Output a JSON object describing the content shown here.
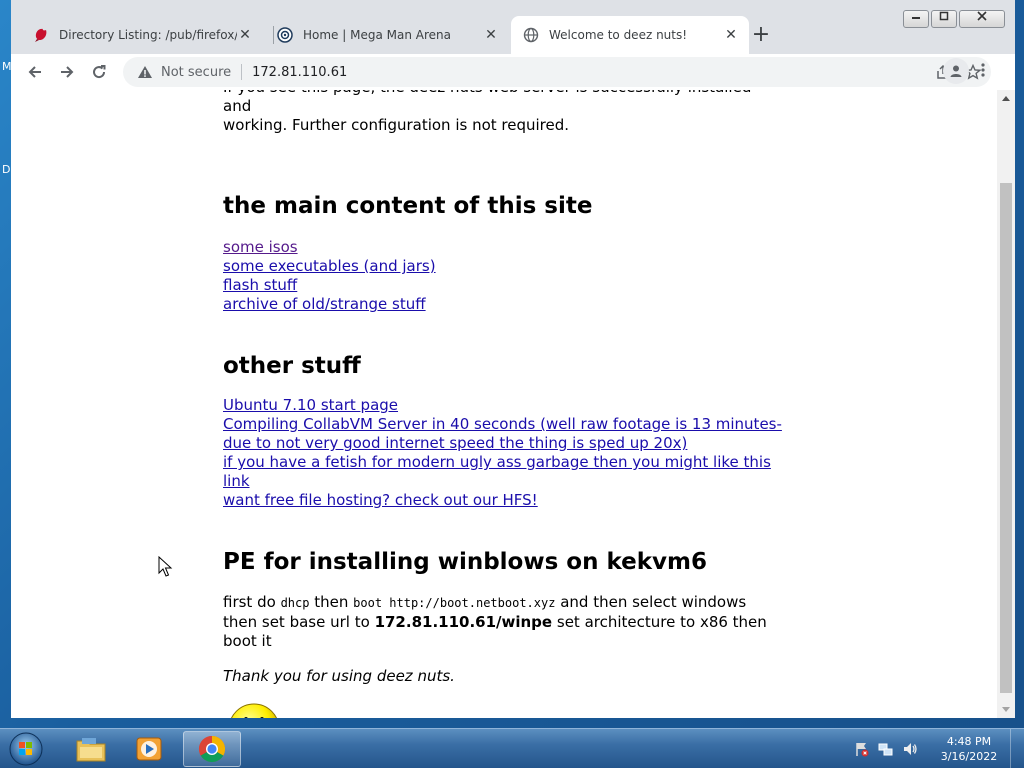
{
  "desktop": {
    "letters": [
      "M",
      "D"
    ]
  },
  "browser": {
    "tabs": [
      {
        "title": "Directory Listing: /pub/firefox/rel",
        "icon": "firefox-red-icon",
        "active": false
      },
      {
        "title": "Home | Mega Man Arena",
        "icon": "gear-site-icon",
        "active": false
      },
      {
        "title": "Welcome to deez nuts!",
        "icon": "globe-icon",
        "active": true
      }
    ],
    "new_tab_label": "+",
    "close_glyph": "✕",
    "omnibox": {
      "security_text": "Not secure",
      "url": "172.81.110.61"
    }
  },
  "page": {
    "intro_partial": "If you see this page, the deez nuts web server is successfully installed and",
    "intro_rest": "working. Further configuration is not required.",
    "section_main": {
      "heading": "the main content of this site",
      "links": [
        {
          "text": "some isos",
          "visited": true
        },
        {
          "text": "some executables (and jars)",
          "visited": false
        },
        {
          "text": "flash stuff",
          "visited": false
        },
        {
          "text": "archive of old/strange stuff",
          "visited": false
        }
      ]
    },
    "section_other": {
      "heading": "other stuff",
      "links": [
        {
          "text": "Ubuntu 7.10 start page"
        },
        {
          "text": "Compiling CollabVM Server in 40 seconds (well raw footage is 13 minutes- due to not very good internet speed the thing is sped up 20x)"
        },
        {
          "text": "if you have a fetish for modern ugly ass garbage then you might like this link"
        },
        {
          "text": "want free file hosting? check out our HFS!"
        }
      ]
    },
    "section_pe": {
      "heading": "PE for installing winblows on kekvm6",
      "p1": "first do",
      "code1": "dhcp",
      "p2": "then",
      "code2": "boot http://boot.netboot.xyz",
      "p3": "and then select windows then set base url to",
      "bold": "172.81.110.61/winpe",
      "p4": "set architecture to x86 then boot it"
    },
    "thanks": "Thank you for using deez nuts."
  },
  "taskbar": {
    "items": [
      {
        "name": "windows-explorer",
        "icon": "folder-icon",
        "active": false
      },
      {
        "name": "media-player",
        "icon": "media-player-icon",
        "active": false
      },
      {
        "name": "chrome",
        "icon": "chrome-icon",
        "active": true
      }
    ],
    "clock": {
      "time": "4:48 PM",
      "date": "3/16/2022"
    }
  },
  "colors": {
    "link": "#1a0dab",
    "visited_link": "#551a8b",
    "taskbar": "#3a6ea5"
  }
}
